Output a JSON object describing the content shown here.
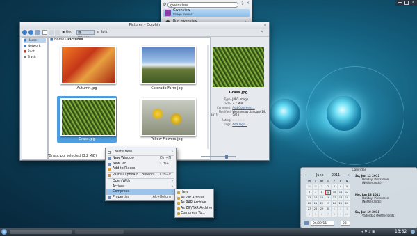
{
  "krunner": {
    "query": "gwenview",
    "results": [
      {
        "name": "Gwenview",
        "desc": "Image Viewer"
      },
      {
        "name": "Run gwenview",
        "desc": ""
      }
    ]
  },
  "dolphin": {
    "title": "Pictures – Dolphin",
    "toolbar": {
      "find": "Find",
      "preview": "Preview",
      "split": "Split"
    },
    "breadcrumb": [
      "Home",
      "Pictures"
    ],
    "places": [
      "Home",
      "Network",
      "Root",
      "Trash"
    ],
    "files": [
      {
        "name": "Autumn.jpg",
        "selected": false
      },
      {
        "name": "Colorado Farm.jpg",
        "selected": false
      },
      {
        "name": "Grass.jpg",
        "selected": true
      },
      {
        "name": "Yellow Flowers.jpg",
        "selected": false
      }
    ],
    "status": "'Grass.jpg' selected (3.2 MiB)",
    "info": {
      "filename": "Grass.jpg",
      "type_label": "Type:",
      "type": "JPEG image",
      "size_label": "Size:",
      "size": "3.2 MiB",
      "comment_label": "Comment:",
      "comment": "Add Comment...",
      "modified_label": "Modified:",
      "modified": "Wednesday, January 19, 2011",
      "modified_time": "2011",
      "rating_label": "Rating:",
      "tags_label": "Tags:",
      "tags": "Add Tags..."
    }
  },
  "context_menu": {
    "items": [
      {
        "label": "Create New",
        "shortcut": "",
        "arrow": true
      },
      {
        "label": "New Window",
        "shortcut": "Ctrl+N",
        "arrow": false
      },
      {
        "label": "New Tab",
        "shortcut": "Ctrl+T",
        "arrow": false
      },
      {
        "label": "Add to Places",
        "shortcut": "",
        "arrow": false
      },
      {
        "label": "Paste Clipboard Contents...",
        "shortcut": "Ctrl+V",
        "arrow": false
      },
      {
        "label": "Open With",
        "shortcut": "",
        "arrow": true
      },
      {
        "label": "Actions",
        "shortcut": "",
        "arrow": true
      },
      {
        "label": "Compress",
        "shortcut": "",
        "arrow": true
      },
      {
        "label": "Properties",
        "shortcut": "Alt+Return",
        "arrow": false
      }
    ],
    "submenu": [
      "Here",
      "As ZIP Archive",
      "As RAR Archive",
      "As ZIP/TAR Archive",
      "Compress To..."
    ]
  },
  "calendar": {
    "title": "Calendar",
    "month": "June",
    "year": "2011",
    "weekdays": [
      "M",
      "T",
      "W",
      "T",
      "F",
      "S",
      "S"
    ],
    "rows": [
      [
        "30",
        "31",
        "1",
        "2",
        "3",
        "4",
        "5"
      ],
      [
        "6",
        "7",
        "8",
        "9",
        "10",
        "11",
        "12"
      ],
      [
        "13",
        "14",
        "15",
        "16",
        "17",
        "18",
        "19"
      ],
      [
        "20",
        "21",
        "22",
        "23",
        "24",
        "25",
        "26"
      ],
      [
        "27",
        "28",
        "29",
        "30",
        "1",
        "2",
        "3"
      ],
      [
        "4",
        "5",
        "6",
        "7",
        "8",
        "9",
        "10"
      ]
    ],
    "today": "9",
    "events": [
      {
        "date": "Su, Jun 12 2011",
        "text": "Holiday: Pinksteren (Netherlands)"
      },
      {
        "date": "Mo, Jun 13 2011",
        "text": "Holiday: Pinksteren (Netherlands)"
      },
      {
        "date": "Su, Jun 19 2011",
        "text": "Vaderdag (Netherlands)"
      }
    ],
    "date_field": "06/09/11",
    "week_field": "23"
  },
  "panel": {
    "clock": "13:32"
  },
  "colors": {
    "selection": "#4f9fe0",
    "accent": "#2563b8",
    "event_red": "#d0383c"
  }
}
